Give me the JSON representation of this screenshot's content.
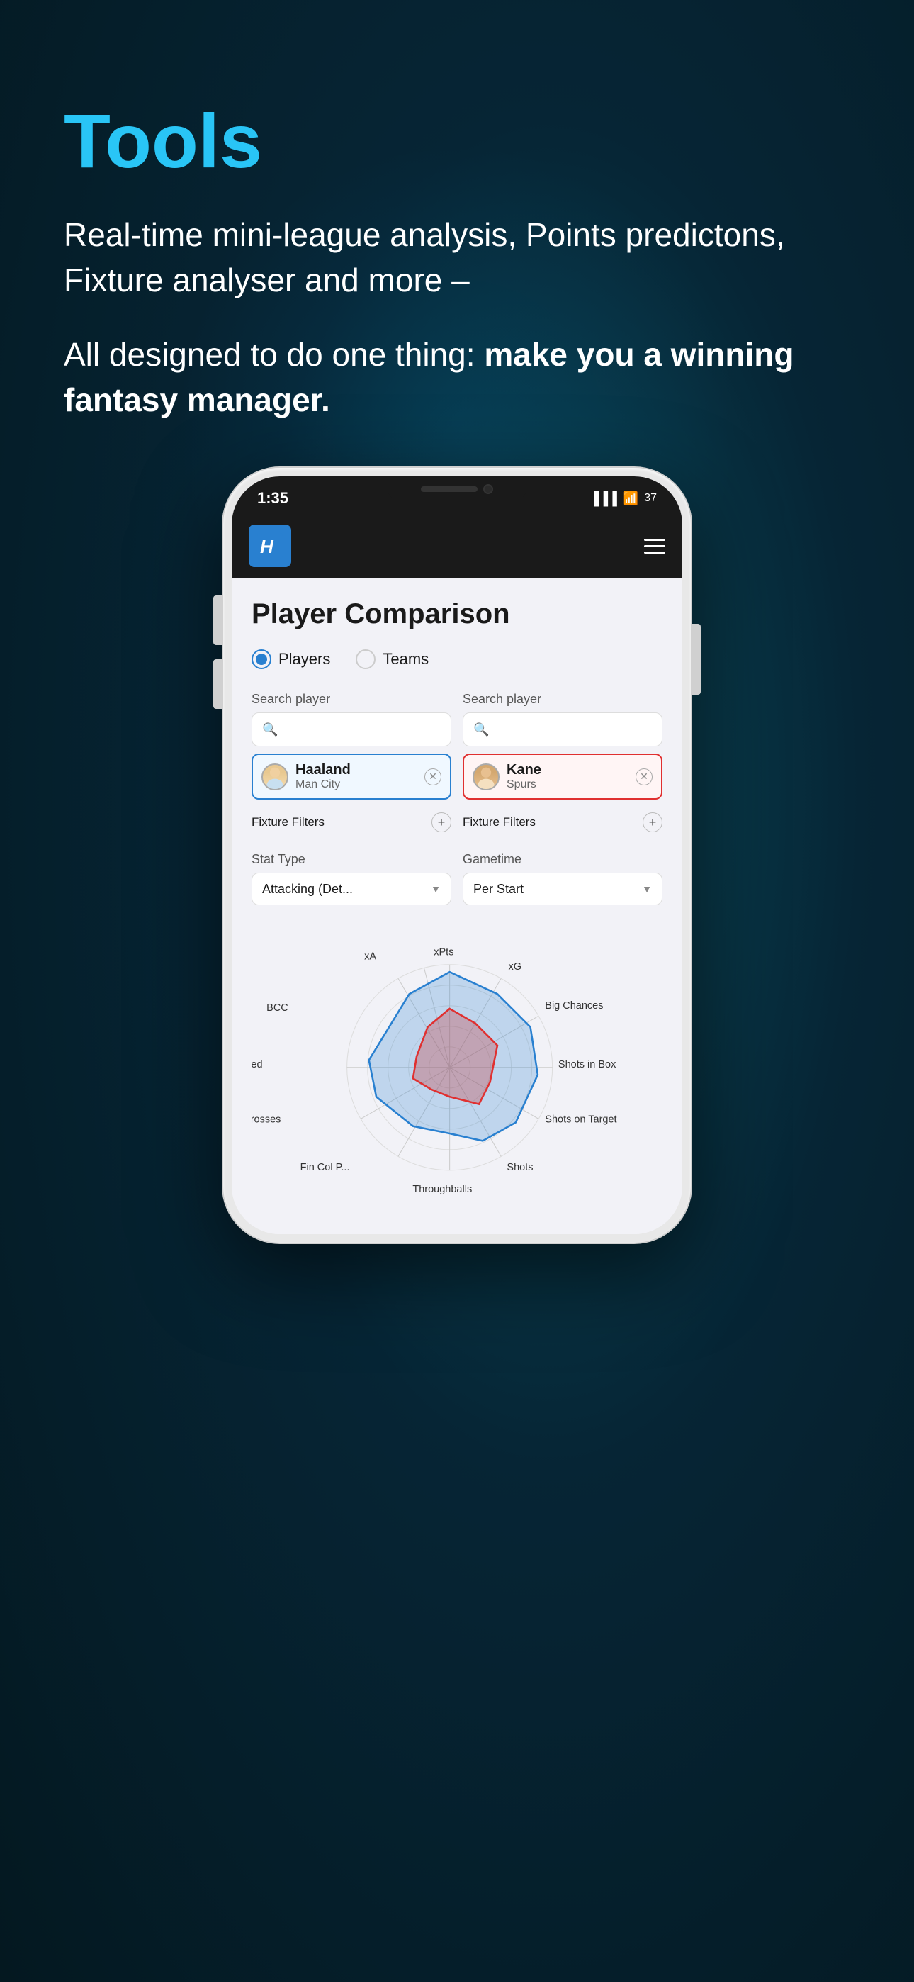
{
  "hero": {
    "title": "Tools",
    "description": "Real-time mini-league analysis, Points predictons, Fixture analyser and more –",
    "tagline_prefix": "All designed to do one thing: ",
    "tagline_bold": "make you a winning fantasy manager."
  },
  "phone": {
    "status_time": "1:35",
    "battery": "37",
    "app_logo_text": "H"
  },
  "app": {
    "page_title": "Player Comparison",
    "radio_players_label": "Players",
    "radio_teams_label": "Teams",
    "search_label_1": "Search player",
    "search_label_2": "Search player",
    "player1": {
      "name": "Haaland",
      "team": "Man City",
      "color": "blue"
    },
    "player2": {
      "name": "Kane",
      "team": "Spurs",
      "color": "red"
    },
    "fixture_filter_label": "Fixture Filters",
    "stat_type_label": "Stat Type",
    "stat_type_value": "Attacking (Det...",
    "gametime_label": "Gametime",
    "gametime_value": "Per Start",
    "radar_labels": {
      "xPts": "xPts",
      "xG": "xG",
      "bigChances": "Big Chances",
      "shotsInBox": "Shots in Box",
      "shotsOnTarget": "Shots on Target",
      "shots": "Shots",
      "throughballs": "Throughballs",
      "crosses": "Crosses",
      "chancesCreated": "Chances Created",
      "bcc": "BCC",
      "xA": "xA"
    }
  }
}
